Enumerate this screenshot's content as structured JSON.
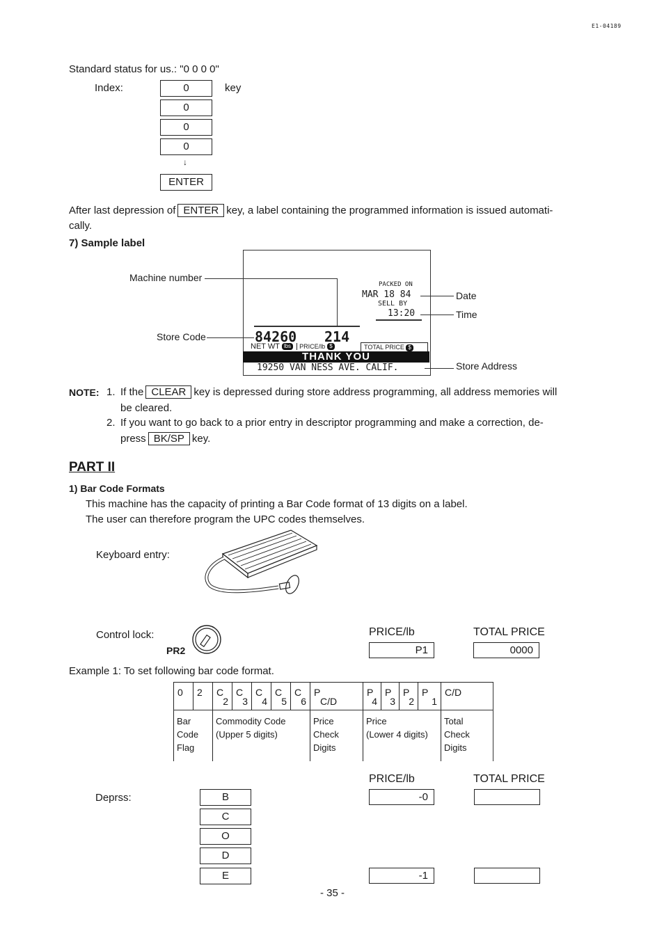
{
  "header": {
    "doc_code": "E1-04189"
  },
  "standard_status": {
    "text": "Standard status for us.: \"0 0 0 0\"",
    "index_label": "Index:",
    "key_label": "key",
    "keys": [
      "0",
      "0",
      "0",
      "0"
    ],
    "arrow": "↓",
    "enter_key": "ENTER"
  },
  "after_enter": {
    "before": "After last depression of",
    "key": "ENTER",
    "after": "key, a label containing the programmed information is issued automati-",
    "line2": "cally."
  },
  "sample_label": {
    "heading": "7)  Sample label",
    "callouts": {
      "machine_number": "Machine number",
      "store_code": "Store Code",
      "date": "Date",
      "time": "Time",
      "store_address": "Store Address"
    },
    "packed_on": "PACKED  ON",
    "date": "MAR 18 84",
    "sell_by": "SELL  BY",
    "time": "13:20",
    "net_wt_value": "84260",
    "price_value": "214",
    "net_wt_label": "NET WT",
    "net_wt_unit": "lbs",
    "price_lb_label": "PRICE/lb",
    "price_unit": "$",
    "total_price_label": "TOTAL PRICE",
    "total_unit": "$",
    "banner": "THANK YOU",
    "address": "19250 VAN NESS AVE. CALIF."
  },
  "notes": {
    "label": "NOTE:",
    "items": [
      {
        "num": "1.",
        "before": "If the",
        "key": "CLEAR",
        "after": "key is depressed during store address programming, all address memories will",
        "line2": "be cleared."
      },
      {
        "num": "2.",
        "line1": "If you want to go back to a prior entry in descriptor programming and make a correction, de-",
        "before": "press",
        "key": "BK/SP",
        "after": "key."
      }
    ]
  },
  "part2": {
    "title": "PART II",
    "section": "1)  Bar Code Formats",
    "para1": "This machine has the capacity of printing a Bar Code format of 13 digits on a label.",
    "para2": "The user can therefore program the UPC codes themselves.",
    "keyboard_label": "Keyboard entry:",
    "control_lock_label": "Control lock:",
    "control_lock_pos": "PR2",
    "display1": {
      "price_label": "PRICE/lb",
      "total_label": "TOTAL PRICE",
      "price_value": "P1",
      "total_value": "0000"
    },
    "example": "Example 1:  To set following bar code format.",
    "table": {
      "top": [
        {
          "main": "0",
          "sub": ""
        },
        {
          "main": "2",
          "sub": ""
        },
        {
          "main": "C",
          "sub": "2"
        },
        {
          "main": "C",
          "sub": "3"
        },
        {
          "main": "C",
          "sub": "4"
        },
        {
          "main": "C",
          "sub": "5"
        },
        {
          "main": "C",
          "sub": "6"
        },
        {
          "main": "P",
          "sub": "C/D"
        },
        {
          "main": "P",
          "sub": "4"
        },
        {
          "main": "P",
          "sub": "3"
        },
        {
          "main": "P",
          "sub": "2"
        },
        {
          "main": "P",
          "sub": "1"
        },
        {
          "main": "C/D",
          "sub": ""
        }
      ],
      "bottom": [
        {
          "lines": [
            "Bar",
            "Code",
            "Flag"
          ]
        },
        {
          "lines": [
            "Commodity Code",
            "(Upper 5 digits)"
          ]
        },
        {
          "lines": [
            "Price",
            "Check",
            "Digits"
          ]
        },
        {
          "lines": [
            "Price",
            "(Lower 4 digits)"
          ]
        },
        {
          "lines": [
            "Total",
            "Check",
            "Digits"
          ]
        }
      ]
    },
    "depress_label": "Deprss:",
    "depress_keys": [
      "B",
      "C",
      "O",
      "D",
      "E"
    ],
    "display2": {
      "price_label": "PRICE/lb",
      "total_label": "TOTAL PRICE",
      "price_value_1": "-0",
      "total_value_1": "",
      "price_value_2": "-1",
      "total_value_2": ""
    }
  },
  "footer": {
    "page": "- 35 -"
  }
}
